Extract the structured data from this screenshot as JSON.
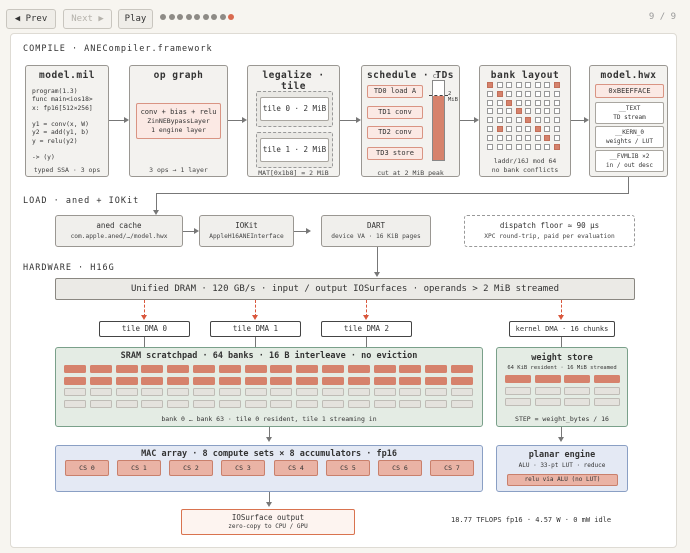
{
  "toolbar": {
    "prev": "◀ Prev",
    "next": "Next ▶",
    "play": "Play",
    "counter": "9 / 9",
    "steps": 9,
    "current": 9
  },
  "compile": {
    "label": "COMPILE · ANECompiler.framework",
    "model_mil": {
      "title": "model.mil",
      "code": "program(1.3)\nfunc main<ios18>\nx: fp16[512×256]\n\ny1 = conv(x, W)\ny2 = add(y1, b)\ny = relu(y2)\n\n-> (y)",
      "footer": "typed SSA · 3 ops"
    },
    "op_graph": {
      "title": "op graph",
      "line1": "conv + bias + relu",
      "line2": "ZinNEBypassLayer",
      "line3": "1 engine layer",
      "footer": "3 ops → 1 layer"
    },
    "legalize": {
      "title": "legalize · tile",
      "tile0": "tile 0 · 2 MiB",
      "tile1": "tile 1 · 2 MiB",
      "footer": "MAT[0x1b8] = 2 MiB"
    },
    "schedule": {
      "title": "schedule · TDs",
      "items": [
        "TD0 load A",
        "TD1 conv",
        "TD2 conv",
        "TD3 store"
      ],
      "c2": "C2",
      "mark": "2 MiB",
      "footer": "cut at 2 MiB peak"
    },
    "bank": {
      "title": "bank layout",
      "footer1": "laddr/16J mod 64",
      "footer2": "no bank conflicts"
    },
    "hwx": {
      "title": "model.hwx",
      "magic": "0xBEEFFACE",
      "text1": "__TEXT",
      "text2": "TD stream",
      "kern1": "__KERN_0",
      "kern2": "weights / LUT",
      "fvm1": "__FVMLIB ×2",
      "fvm2": "in / out desc"
    }
  },
  "load": {
    "label": "LOAD · aned + IOKit",
    "aned": {
      "title": "aned cache",
      "sub": "com.apple.aned/…/model.hwx"
    },
    "iokit": {
      "title": "IOKit",
      "sub": "AppleH16ANEInterface"
    },
    "dart": {
      "title": "DART",
      "sub": "device VA · 16 KiB pages"
    },
    "dispatch": {
      "title": "dispatch floor ≈ 90 µs",
      "sub": "XPC round-trip, paid per evaluation"
    }
  },
  "hardware": {
    "label": "HARDWARE · H16G",
    "dram": "Unified DRAM · 120 GB/s · input / output IOSurfaces · operands > 2 MiB streamed",
    "tile_dma": [
      "tile DMA 0",
      "tile DMA 1",
      "tile DMA 2"
    ],
    "kernel_dma": "kernel DMA · 16 chunks",
    "sram": {
      "title": "SRAM scratchpad · 64 banks · 16 B interleave · no eviction",
      "footer": "bank 0 … bank 63 · tile 0 resident, tile 1 streaming in"
    },
    "weight": {
      "title": "weight store",
      "sub": "64 KiB resident · 16 MiB streamed",
      "footer": "STEP = weight_bytes / 16"
    },
    "mac": {
      "title": "MAC array · 8 compute sets × 8 accumulators · fp16",
      "cs": [
        "CS 0",
        "CS 1",
        "CS 2",
        "CS 3",
        "CS 4",
        "CS 5",
        "CS 6",
        "CS 7"
      ]
    },
    "planar": {
      "title": "planar engine",
      "sub": "ALU · 33-pt LUT · reduce",
      "tag": "relu via ALU (no LUT)"
    },
    "iosurface": {
      "title": "IOSurface output",
      "sub": "zero-copy to CPU / GPU"
    },
    "stats": "18.77 TFLOPS fp16 · 4.57 W · 0 mW idle"
  },
  "colors": {
    "accent": "#d96a4f",
    "cell_active": "#d6826c",
    "cell_idle": "#e4e2dd"
  }
}
